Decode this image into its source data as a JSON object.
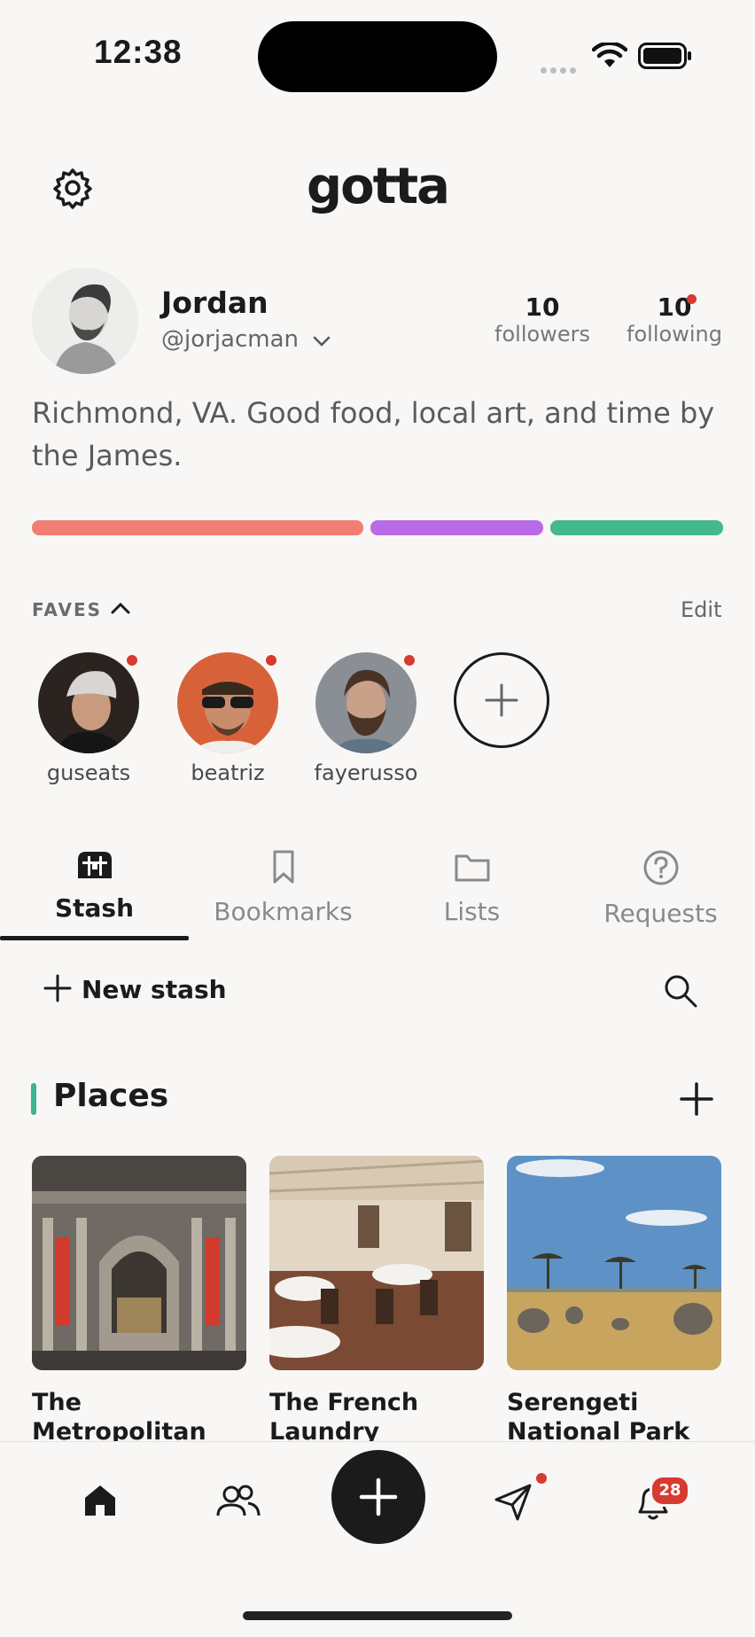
{
  "status_bar": {
    "time": "12:38"
  },
  "header": {
    "logo": "gotta"
  },
  "profile": {
    "name": "Jordan",
    "handle": "@jorjacman",
    "followers_count": "10",
    "followers_label": "followers",
    "following_count": "10",
    "following_label": "following",
    "bio": "Richmond, VA. Good food, local art, and time by the James.",
    "bars": [
      {
        "color": "#f27d73",
        "fraction": 0.49
      },
      {
        "color": "#b96be6",
        "fraction": 0.255
      },
      {
        "color": "#45b98e",
        "fraction": 0.255
      }
    ]
  },
  "faves": {
    "title": "FAVES",
    "edit_label": "Edit",
    "people": [
      {
        "name": "guseats"
      },
      {
        "name": "beatriz"
      },
      {
        "name": "fayerusso"
      }
    ]
  },
  "tabs": [
    {
      "label": "Stash",
      "icon": "chest-icon",
      "active": true
    },
    {
      "label": "Bookmarks",
      "icon": "bookmark-icon",
      "active": false
    },
    {
      "label": "Lists",
      "icon": "folder-icon",
      "active": false
    },
    {
      "label": "Requests",
      "icon": "question-icon",
      "active": false
    }
  ],
  "stash": {
    "new_label": "New stash"
  },
  "places": {
    "title": "Places",
    "accent": "#3cb48f",
    "items": [
      {
        "title": "The Metropolitan Museum of Art"
      },
      {
        "title": "The French Laundry"
      },
      {
        "title": "Serengeti National Park"
      }
    ]
  },
  "bottom_nav": {
    "items": [
      "home-icon",
      "people-icon",
      "add-icon",
      "send-icon",
      "bell-icon"
    ],
    "notifications_badge": "28"
  }
}
